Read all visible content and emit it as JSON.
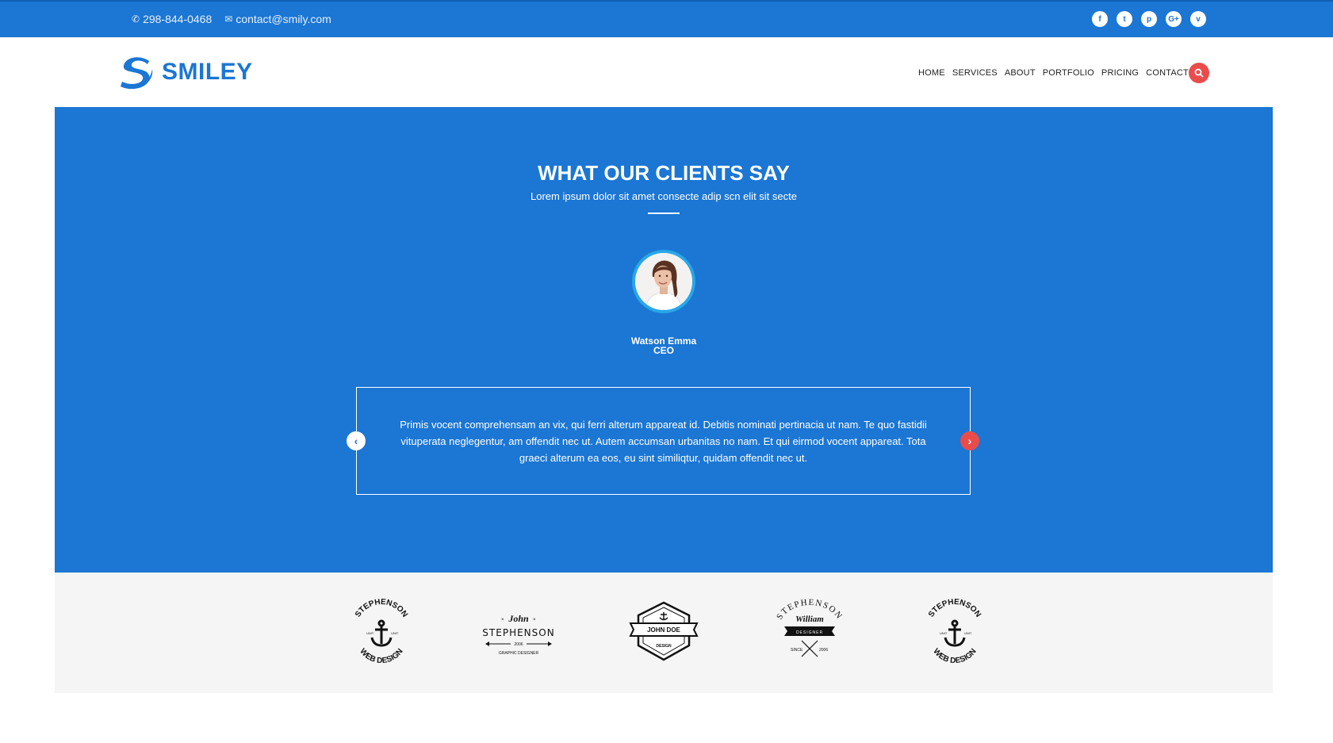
{
  "topbar": {
    "phone": "298-844-0468",
    "email": "contact@smily.com",
    "socials": [
      {
        "icon": "facebook-icon",
        "glyph": "f"
      },
      {
        "icon": "twitter-icon",
        "glyph": "t"
      },
      {
        "icon": "pinterest-icon",
        "glyph": "p"
      },
      {
        "icon": "google-plus-icon",
        "glyph": "G+"
      },
      {
        "icon": "vimeo-icon",
        "glyph": "v"
      }
    ]
  },
  "header": {
    "logo_text": "SMILEY",
    "nav": [
      "HOME",
      "SERVICES",
      "ABOUT",
      "PORTFOLIO",
      "PRICING",
      "CONTACT US"
    ]
  },
  "testimonials": {
    "title": "WHAT OUR CLIENTS SAY",
    "subtitle": "Lorem ipsum dolor sit amet consecte adip scn elit sit secte",
    "person_name": "Watson Emma",
    "person_role": "CEO",
    "quote": "Primis vocent comprehensam an vix, qui ferri alterum appareat id. Debitis nominati pertinacia ut nam. Te quo fastidii vituperata neglegentur, am offendit nec ut. Autem accumsan urbanitas no nam. Et qui eirmod vocent appareat. Tota graeci alterum ea eos, eu sint similiqtur, quidam offendit nec ut.",
    "prev_glyph": "‹",
    "next_glyph": "›"
  },
  "brands": {
    "logo1": {
      "top": "STEPHENSON",
      "bottom": "WEB DESIGN",
      "left": "UNIT",
      "right": "UNIT"
    },
    "logo2": {
      "script": "John",
      "name": "STEPHENSON",
      "year": "2006",
      "role": "GRAPHIC DESIGNER"
    },
    "logo3": {
      "name": "JOHN DOE",
      "role": "DESIGN"
    },
    "logo4": {
      "top": "STEPHENSON",
      "script": "William",
      "banner": "DESIGNER",
      "since": "SINCE",
      "year": "2006"
    },
    "logo5": {
      "top": "STEPHENSON",
      "bottom": "WEB DESIGN",
      "left": "UNIT",
      "right": "UNIT"
    }
  },
  "colors": {
    "primary": "#1b76d4",
    "accent": "#ea4c4c",
    "avatar_ring": "#29a7e8",
    "brands_bg": "#f5f5f5"
  }
}
